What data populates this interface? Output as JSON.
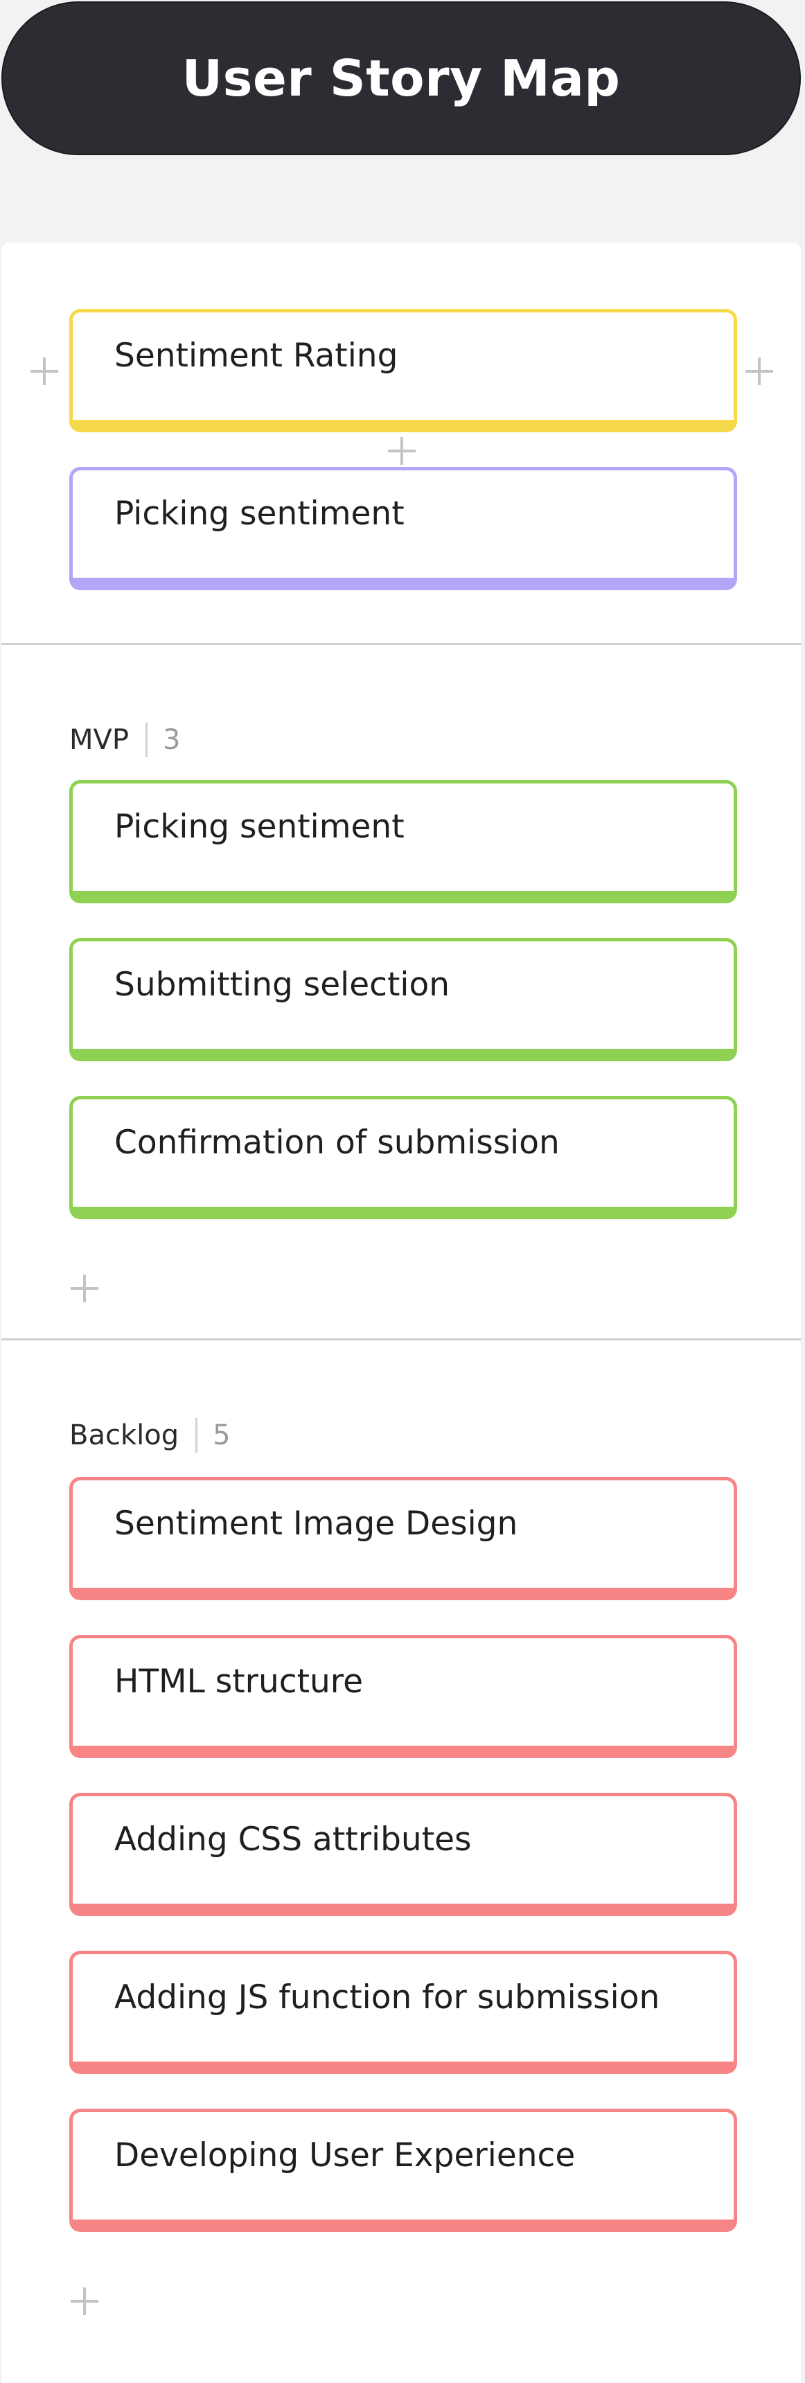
{
  "title": "User Story Map",
  "colors": {
    "yellow": "#f6d94a",
    "purple": "#b2a7f7",
    "green": "#8ed153",
    "red": "#f78585"
  },
  "activity": {
    "card_label": "Sentiment Rating"
  },
  "step": {
    "card_label": "Picking sentiment"
  },
  "mvp": {
    "name": "MVP",
    "count": "3",
    "cards": [
      "Picking sentiment",
      "Submitting selection",
      "Confirmation of submission"
    ]
  },
  "backlog": {
    "name": "Backlog",
    "count": "5",
    "cards": [
      "Sentiment Image Design",
      "HTML structure",
      "Adding CSS attributes",
      "Adding JS function for submission",
      "Developing User Experience"
    ]
  }
}
